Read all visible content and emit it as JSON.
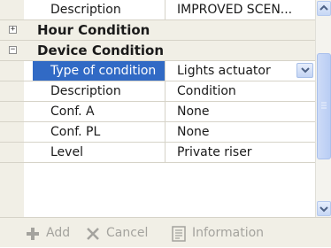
{
  "rows": {
    "description_top": {
      "name": "Description",
      "value": "IMPROVED SCEN..."
    },
    "hour_condition": {
      "label": "Hour Condition",
      "toggle": "+"
    },
    "device_condition": {
      "label": "Device Condition",
      "toggle": "−"
    },
    "type_of_condition": {
      "name": "Type of condition",
      "value": "Lights actuator"
    },
    "description": {
      "name": "Description",
      "value": "Condition"
    },
    "conf_a": {
      "name": "Conf. A",
      "value": "None"
    },
    "conf_pl": {
      "name": "Conf. PL",
      "value": "None"
    },
    "level": {
      "name": "Level",
      "value": "Private riser"
    }
  },
  "toolbar": {
    "add_label": "Add",
    "cancel_label": "Cancel",
    "information_label": "Information"
  },
  "colors": {
    "selection": "#316ac5",
    "category_bg": "#f1efe6",
    "disabled_text": "#a4a39e"
  }
}
